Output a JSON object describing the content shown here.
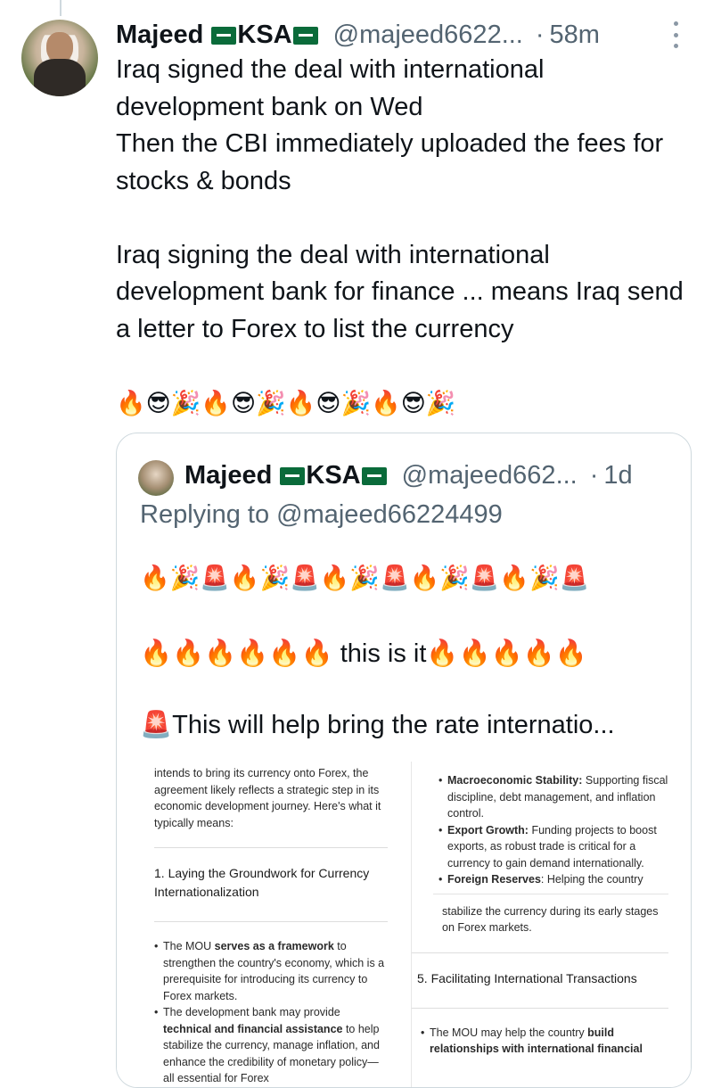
{
  "tweet": {
    "display_name": "Majeed",
    "display_name_suffix": "KSA",
    "handle": "@majeed6622...",
    "time": "58m",
    "body": "Iraq signed the deal with international development bank on Wed\nThen the CBI immediately uploaded the fees for stocks & bonds\n\nIraq signing the deal with international development bank for finance ... means Iraq send a letter to Forex to list the currency",
    "emoji_line": "🔥😎🎉🔥😎🎉🔥😎🎉🔥😎🎉"
  },
  "quoted_tweet": {
    "display_name": "Majeed",
    "display_name_suffix": "KSA",
    "handle": "@majeed662...",
    "time": "1d",
    "replying_to": "Replying to @majeed66224499",
    "line1": "🔥🎉🚨🔥🎉🚨🔥🎉🚨🔥🎉🚨🔥🎉🚨",
    "line2_prefix": "🔥🔥🔥🔥🔥🔥",
    "line2_text": " this is it",
    "line2_suffix": "🔥🔥🔥🔥🔥",
    "line3": "🚨This will help bring the rate internatio..."
  },
  "screenshot": {
    "left": {
      "intro": "intends to bring its currency onto Forex, the agreement likely reflects a strategic step in its economic development journey. Here's what it typically means:",
      "heading": "1. Laying the Groundwork for Currency Internationalization",
      "b1_pre": "The MOU ",
      "b1_bold": "serves as a framework",
      "b1_post": " to strengthen the country's economy, which is a prerequisite for introducing its currency to Forex markets.",
      "b2_pre": "The development bank may provide ",
      "b2_bold": "technical and financial assistance",
      "b2_post": " to help stabilize the currency, manage inflation, and enhance the credibility of monetary policy—all essential for Forex"
    },
    "right": {
      "r1_bold": "Macroeconomic Stability:",
      "r1_text": " Supporting fiscal discipline, debt management, and inflation control.",
      "r2_bold": "Export Growth:",
      "r2_text": " Funding projects to boost exports, as robust trade is critical for a currency to gain demand internationally.",
      "r3_bold": "Foreign Reserves",
      "r3_text": ": Helping the country",
      "r3_cont": "stabilize the currency during its early stages on Forex markets.",
      "heading": "5. Facilitating International Transactions",
      "r4_pre": "The MOU may help the country ",
      "r4_bold": "build relationships with international financial"
    }
  }
}
